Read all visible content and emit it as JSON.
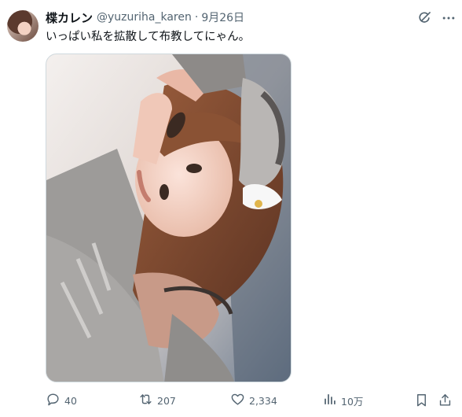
{
  "tweet": {
    "display_name": "楪カレン",
    "handle": "@yuzuriha_karen",
    "separator": "·",
    "date": "9月26日",
    "text": "いっぱい私を拡散して布教してにゃん。"
  },
  "icons": {
    "avatar": "profile-avatar",
    "grok": "grok-icon",
    "more": "more-icon",
    "reply": "reply-icon",
    "retweet": "retweet-icon",
    "like": "heart-icon",
    "views": "views-icon",
    "bookmark": "bookmark-icon",
    "share": "share-icon"
  },
  "actions": {
    "replies": "40",
    "retweets": "207",
    "likes": "2,334",
    "views": "10万"
  },
  "colors": {
    "text_primary": "#0f1419",
    "text_secondary": "#536471",
    "border": "#cfd9de"
  }
}
